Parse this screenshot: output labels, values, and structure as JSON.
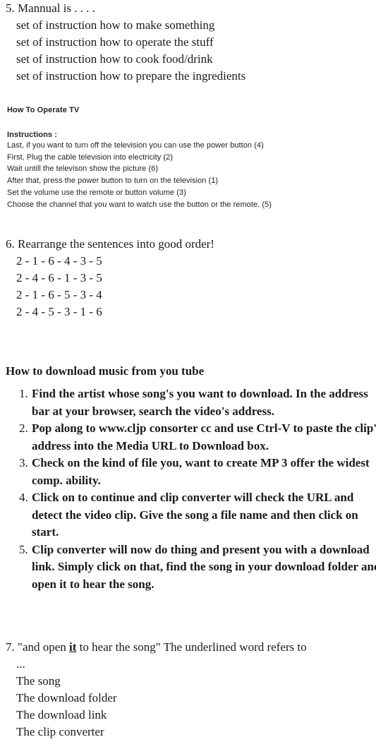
{
  "question5": {
    "stem": "5. Mannual is . . . .",
    "options": [
      "set of instruction how to make something",
      "set of instruction how to operate the stuff",
      "set of instruction how to cook food/drink",
      "set of instruction how to prepare the ingredients"
    ]
  },
  "passage": {
    "title": "How To Operate TV",
    "subtitle": "Instructions :",
    "lines": [
      "Last, if you want to turn off the television you can use the power button (4)",
      "First, Plug the cable television into electricity (2)",
      "Wait untill the televison show the picture (6)",
      "After that, press the power button to turn on the television (1)",
      "Set the volume use the remote or button volume (3)",
      "Choose the channel that you want to watch use the button or the remote. (5)"
    ]
  },
  "question6": {
    "stem": "6. Rearrange the sentences into good order!",
    "options": [
      "2 - 1 - 6 - 4 - 3 - 5",
      "2 - 4 - 6 - 1 - 3 - 5",
      "2 - 1 - 6 - 5 - 3 - 4",
      "2 - 4 - 5 - 3 - 1 - 6"
    ]
  },
  "download_section": {
    "heading": "How to download music from you tube",
    "steps": [
      {
        "number": "1.",
        "text": "Find the artist whose song's you want to download. In the address bar at your browser, search the video's address."
      },
      {
        "number": "2.",
        "text": "Pop along to www.cljp consorter cc and use Ctrl-V to paste the clip's address into the Media URL to Download box."
      },
      {
        "number": "3.",
        "text": "Check on the kind of file you, want to create MP 3 offer the widest comp. ability."
      },
      {
        "number": "4.",
        "text": "Click on to continue and clip converter will check the URL and detect the video clip. Give the song a file name and then click on start."
      },
      {
        "number": "5.",
        "text": "Clip converter will now do thing and present you with a download link. Simply click on that, find the song in your download folder and open it to hear the song."
      }
    ]
  },
  "question7": {
    "stem_prefix": "7. \"and open ",
    "stem_underlined": "it",
    "stem_suffix": " to hear the song\" The underlined word refers to",
    "ellipsis": "...",
    "options": [
      "The song",
      "The download folder",
      "The download link",
      "The clip converter"
    ]
  }
}
